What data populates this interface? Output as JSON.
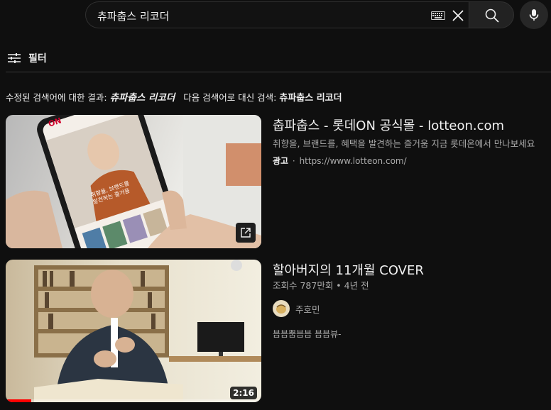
{
  "search": {
    "query": "츄파춥스 리코더"
  },
  "filter": {
    "label": "필터"
  },
  "correction": {
    "prefix": "수정된 검색어에 대한 결과: ",
    "corrected_query": "츄파춥스 리코더",
    "alt_prefix": "다음 검색어로 대신 검색: ",
    "original_query": "츄파춥스 리코더"
  },
  "results": [
    {
      "type": "ad",
      "title": "춥파춥스 - 롯데ON 공식몰 - lotteon.com",
      "description": "취향을, 브랜드를, 혜택을 발견하는 즐거움 지금 롯데온에서 만나보세요",
      "ad_label": "광고",
      "separator": "·",
      "url": "https://www.lotteon.com/",
      "thumb_text": {
        "logo": "ON",
        "phone_caption": "취향을, 브랜드를\n발견하는 즐거움"
      }
    },
    {
      "type": "video",
      "title": "할아버지의 11개월 COVER",
      "meta": "조회수 787만회 • 4년 전",
      "channel": "주호민",
      "snippet": "븝븝뿝븝븝 븝븝뷰-",
      "duration": "2:16",
      "watched_progress": 0.1
    }
  ],
  "colors": {
    "background": "#0f0f0f",
    "text_primary": "#f1f1f1",
    "text_secondary": "#aaaaaa",
    "progress": "#ff0000"
  },
  "icons": [
    "keyboard-icon",
    "clear-icon",
    "search-icon",
    "mic-icon",
    "filter-icon",
    "external-link-icon"
  ]
}
